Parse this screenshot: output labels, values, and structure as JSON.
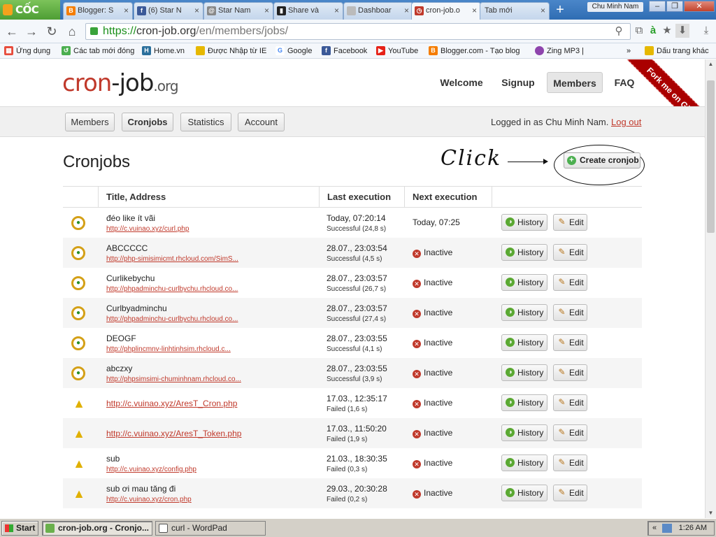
{
  "browser": {
    "brand": "CỐC CỐC",
    "tabs": [
      {
        "label": "Blogger: S",
        "icon": "blogger-icon",
        "color": "#f57d00"
      },
      {
        "label": "(6) Star N",
        "icon": "facebook-icon",
        "color": "#3b5998"
      },
      {
        "label": "Star Nam",
        "icon": "spiral-icon",
        "color": "#666666"
      },
      {
        "label": "Share và",
        "icon": "document-icon",
        "color": "#222222"
      },
      {
        "label": "Dashboar",
        "icon": "page-icon",
        "color": "#999999"
      },
      {
        "label": "cron-job.o",
        "icon": "cronjob-icon",
        "color": "#c0392b"
      },
      {
        "label": "Tab mới",
        "icon": "",
        "color": ""
      }
    ],
    "user": "Chu Minh Nam",
    "url": {
      "scheme": "https://",
      "host": "cron-job.org",
      "path": "/en/members/jobs/"
    },
    "bookmarks": [
      {
        "label": "Ứng dụng",
        "color": "#e74c3c"
      },
      {
        "label": "Các tab mới đóng",
        "color": "#4caf50"
      },
      {
        "label": "Home.vn",
        "color": "#2a6f9c"
      },
      {
        "label": "Được Nhập từ IE",
        "color": "#e6b800"
      },
      {
        "label": "Google",
        "color": "#4285f4"
      },
      {
        "label": "Facebook",
        "color": "#3b5998"
      },
      {
        "label": "YouTube",
        "color": "#e62117"
      },
      {
        "label": "Blogger.com - Tạo blog",
        "color": "#f57d00"
      },
      {
        "label": "Zing MP3 |",
        "color": "#8e44ad"
      }
    ],
    "bookmarks_more": "»",
    "bookmarks_other": "Dấu trang khác"
  },
  "site": {
    "logo": {
      "part1": "cr",
      "part1b": "on",
      "part2": "-job",
      "part3": ".org"
    },
    "nav": [
      "Welcome",
      "Signup",
      "Members",
      "FAQ"
    ],
    "ribbon": "Fork me on GitHub",
    "subnav": [
      "Members",
      "Cronjobs",
      "Statistics",
      "Account"
    ],
    "logged_in_prefix": "Logged in as Chu Minh Nam.",
    "logout": "Log out"
  },
  "main": {
    "heading": "Cronjobs",
    "annotation": "Click",
    "create_button": "Create cronjob",
    "columns": [
      "Title, Address",
      "Last execution",
      "Next execution"
    ],
    "history_label": "History",
    "edit_label": "Edit",
    "inactive_label": "Inactive",
    "rows": [
      {
        "kind": "clock",
        "title": "đéo like ít vãi",
        "address": "http://c.vuinao.xyz/curl.php",
        "last": "Today, 07:20:14",
        "status": "Successful (24,8 s)",
        "next": "Today, 07:25"
      },
      {
        "kind": "clock",
        "title": "ABCCCCC",
        "address": "http://php-simisimicmt.rhcloud.com/SimS...",
        "last": "28.07., 23:03:54",
        "status": "Successful (4,5 s)",
        "next": ""
      },
      {
        "kind": "clock",
        "title": "Curlikebychu",
        "address": "http://phpadminchu-curlbychu.rhcloud.co...",
        "last": "28.07., 23:03:57",
        "status": "Successful (26,7 s)",
        "next": ""
      },
      {
        "kind": "clock",
        "title": "Curlbyadminchu",
        "address": "http://phpadminchu-curlbychu.rhcloud.co...",
        "last": "28.07., 23:03:57",
        "status": "Successful (27,4 s)",
        "next": ""
      },
      {
        "kind": "clock",
        "title": "DEOGF",
        "address": "http://phplincmnv-linhtinhsim.rhcloud.c...",
        "last": "28.07., 23:03:55",
        "status": "Successful (4,1 s)",
        "next": ""
      },
      {
        "kind": "clock",
        "title": "abczxy",
        "address": "http://phpsimsimi-chuminhnam.rhcloud.co...",
        "last": "28.07., 23:03:55",
        "status": "Successful (3,9 s)",
        "next": ""
      },
      {
        "kind": "warn",
        "title": "",
        "address": "http://c.vuinao.xyz/AresT_Cron.php",
        "last": "17.03., 12:35:17",
        "status": "Failed (1,6 s)",
        "next": ""
      },
      {
        "kind": "warn",
        "title": "",
        "address": "http://c.vuinao.xyz/AresT_Token.php",
        "last": "17.03., 11:50:20",
        "status": "Failed (1,9 s)",
        "next": ""
      },
      {
        "kind": "warn",
        "title": "sub",
        "address": "http://c.vuinao.xyz/config.php",
        "last": "21.03., 18:30:35",
        "status": "Failed (0,3 s)",
        "next": ""
      },
      {
        "kind": "warn",
        "title": "sub ơi mau tăng đi",
        "address": "http://c.vuinao.xyz/cron.php",
        "last": "29.03., 20:30:28",
        "status": "Failed (0,2 s)",
        "next": ""
      }
    ]
  },
  "taskbar": {
    "start": "Start",
    "tasks": [
      "cron-job.org - Cronjo...",
      "curl - WordPad"
    ],
    "tray_more": "«",
    "time": "1:26 AM"
  },
  "colors": {
    "accent": "#c0392b",
    "success": "#5aa832",
    "warning": "#e0b000"
  }
}
